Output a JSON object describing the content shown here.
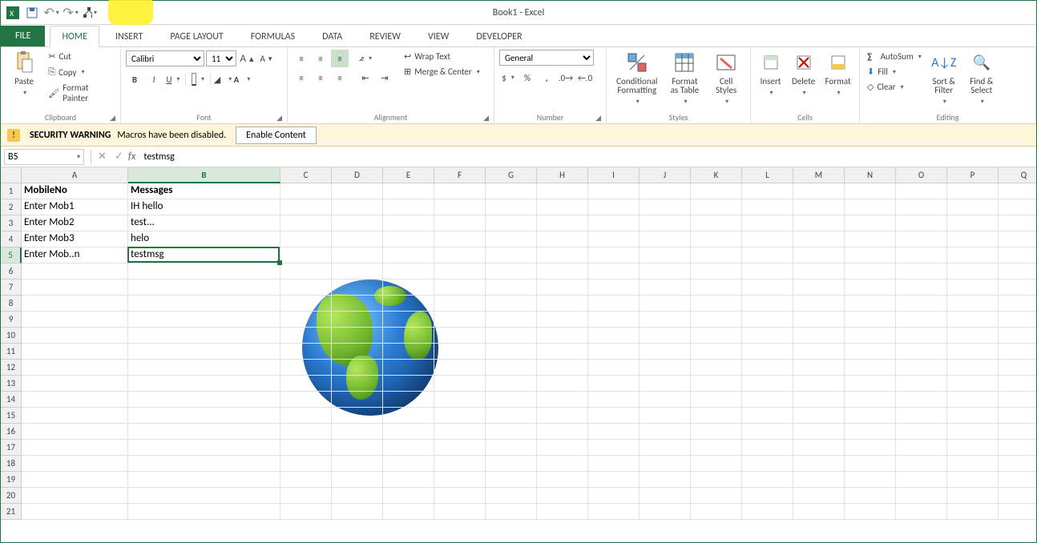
{
  "title": "Book1 - Excel",
  "tabs": {
    "file": "FILE",
    "home": "HOME",
    "insert": "INSERT",
    "pagelayout": "PAGE LAYOUT",
    "formulas": "FORMULAS",
    "data": "DATA",
    "review": "REVIEW",
    "view": "VIEW",
    "developer": "DEVELOPER"
  },
  "active_tab": "HOME",
  "ribbon": {
    "clipboard": {
      "label": "Clipboard",
      "paste": "Paste",
      "cut": "Cut",
      "copy": "Copy",
      "fmtpainter": "Format Painter"
    },
    "font": {
      "label": "Font",
      "name": "Calibri",
      "size": "11"
    },
    "alignment": {
      "label": "Alignment",
      "wrap": "Wrap Text",
      "merge": "Merge & Center"
    },
    "number": {
      "label": "Number",
      "format": "General"
    },
    "styles": {
      "label": "Styles",
      "cond": "Conditional Formatting",
      "table": "Format as Table",
      "cell": "Cell Styles"
    },
    "cells": {
      "label": "Cells",
      "insert": "Insert",
      "delete": "Delete",
      "format": "Format"
    },
    "editing": {
      "label": "Editing",
      "autosum": "AutoSum",
      "fill": "Fill",
      "clear": "Clear",
      "sort": "Sort & Filter",
      "find": "Find & Select"
    }
  },
  "security": {
    "title": "SECURITY WARNING",
    "msg": "Macros have been disabled.",
    "btn": "Enable Content"
  },
  "namebox": "B5",
  "formula": "testmsg",
  "columns": [
    "A",
    "B",
    "C",
    "D",
    "E",
    "F",
    "G",
    "H",
    "I",
    "J",
    "K",
    "L",
    "M",
    "N",
    "O",
    "P",
    "Q"
  ],
  "col_widths": {
    "default": 64,
    "A": 133,
    "B": 190
  },
  "row_count": 21,
  "selected_cell": {
    "col": "B",
    "row": 5
  },
  "cells": {
    "A1": "MobileNo",
    "B1": "Messages",
    "A2": "Enter Mob1",
    "B2": "IH hello",
    "A3": "Enter Mob2",
    "B3": "test...",
    "A4": "Enter Mob3",
    "B4": "helo",
    "A5": "Enter Mob..n",
    "B5": "testmsg"
  },
  "bold_cells": [
    "A1",
    "B1"
  ]
}
